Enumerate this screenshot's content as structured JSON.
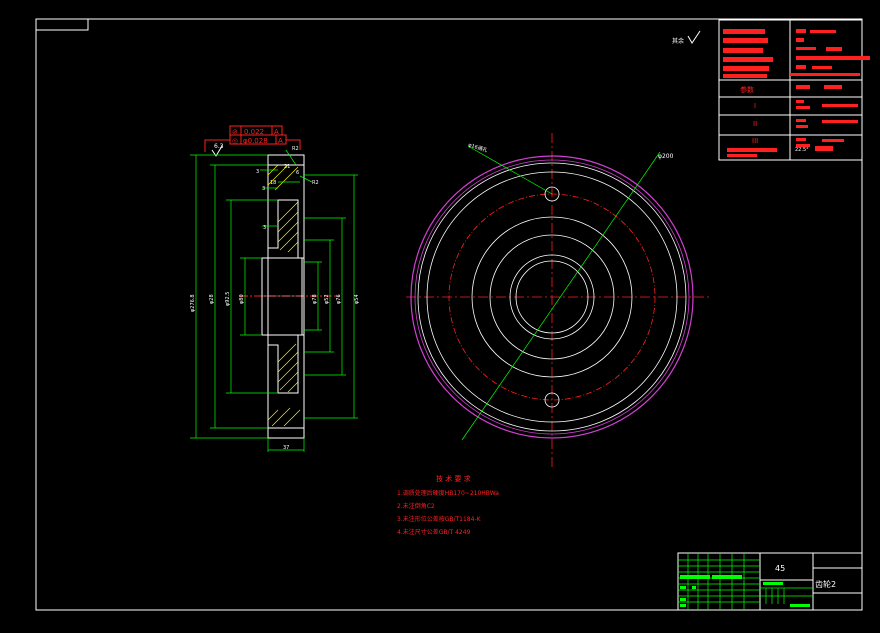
{
  "colors": {
    "background": "#000000",
    "frame": "#ffffff",
    "green": "#00ff00",
    "red": "#ff2020",
    "magenta": "#d040d0",
    "hatch": "#ffff00"
  },
  "tolerance_frame": {
    "flatness_symbol": "⊘",
    "flatness_value": "0.022",
    "flatness_datum": "A",
    "runout_symbol": "◎",
    "runout_value": "φ0.028",
    "runout_datum": "A"
  },
  "surface_finish": {
    "mark": "6.3",
    "corner_note": "其余"
  },
  "section_dims": {
    "bore_dia_1": "φ276.8",
    "bore_dia_2": "φ28",
    "dia_125": "φ92.5",
    "dia_80": "φ80",
    "dia_right_1": "φ78",
    "dia_right_2": "φ52",
    "dia_right_3": "φ76",
    "dia_right_4": "φ54",
    "dim_top": "R2",
    "dim_offset_1": "3",
    "dim_offset_2": "3",
    "dim_21": "21",
    "dim_18": "18",
    "dim_r": "R2",
    "dim_bottom": "37",
    "dim_left_a": "6",
    "dim_left_b": "3"
  },
  "front_view": {
    "hole_note": "φ16通孔",
    "pcd_label": "φ200"
  },
  "tech_requirements": {
    "title": "技 术 要 求",
    "items": [
      "1.调质处理后硬度HB170~210HBWa",
      "2.未注倒角C2",
      "3.未注形位公差按GB/T1184-K",
      "4.未注尺寸公差GB/T 4249"
    ]
  },
  "title_block": {
    "material": "45",
    "part_name": "齿轮2"
  },
  "param_table": {
    "col_header": "参数",
    "row_labels": [
      "I",
      "II",
      "III"
    ],
    "footer": "22.5°"
  }
}
